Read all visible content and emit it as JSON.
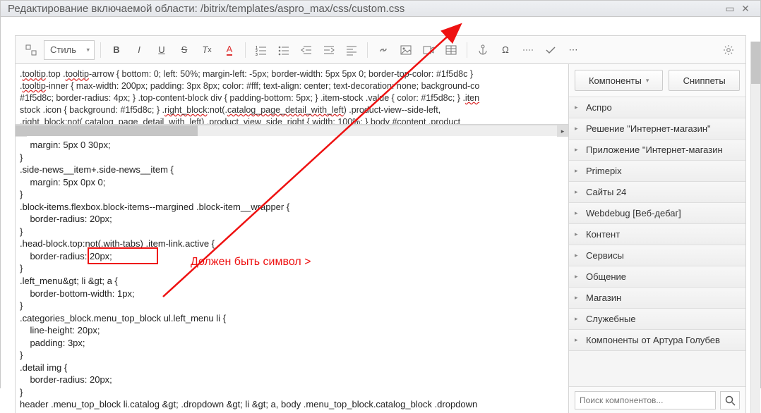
{
  "window": {
    "title": "Редактирование включаемой области: /bitrix/templates/aspro_max/css/custom.css"
  },
  "toolbar": {
    "style_label": "Стиль"
  },
  "css_top_lines": [
    ".tooltip.top .tooltip-arrow { bottom: 0; left: 50%; margin-left: -5px; border-width: 5px 5px 0; border-top-color: #1f5d8c }",
    ".tooltip-inner { max-width: 200px; padding: 3px 8px; color: #fff; text-align: center; text-decoration: none; background-co",
    "#1f5d8c; border-radius: 4px; } .top-content-block div { padding-bottom: 5px; } .item-stock .value { color: #1f5d8c; } .iten",
    "stock .icon { background: #1f5d8c; } .right_block:not(.catalog_page_detail_with_left) .product-view--side-left,",
    ".right_block:not( catalog_page_detail_with_left) .product_view_side_right { width: 100%; } body #content .product"
  ],
  "code_lines": [
    "    margin: 5px 0 30px;",
    "}",
    ".side-news__item+.side-news__item {",
    "    margin: 5px 0px 0;",
    "}",
    ".block-items.flexbox.block-items--margined .block-item__wrapper {",
    "    border-radius: 20px;",
    "}",
    ".head-block.top:not(.with-tabs) .item-link.active {",
    "    border-radius: 20px;",
    "}",
    ".left_menu&gt; li &gt; a {",
    "    border-bottom-width: 1px;",
    "}",
    ".categories_block.menu_top_block ul.left_menu li {",
    "    line-height: 20px;",
    "    padding: 3px;",
    "}",
    ".detail img {",
    "    border-radius: 20px;",
    "}",
    "header .menu_top_block li.catalog &gt; .dropdown &gt; li &gt; a, body .menu_top_block.catalog_block .dropdown"
  ],
  "annotation": {
    "text": "Должен быть символ >"
  },
  "side": {
    "components_btn": "Компоненты",
    "snippets_btn": "Сниппеты",
    "items": [
      "Аспро",
      "Решение \"Интернет-магазин\"",
      "Приложение \"Интернет-магазин",
      "Primepix",
      "Сайты 24",
      "Webdebug [Веб-дебаг]",
      "Контент",
      "Сервисы",
      "Общение",
      "Магазин",
      "Служебные",
      "Компоненты от Артура Голубев"
    ],
    "search_placeholder": "Поиск компонентов..."
  }
}
